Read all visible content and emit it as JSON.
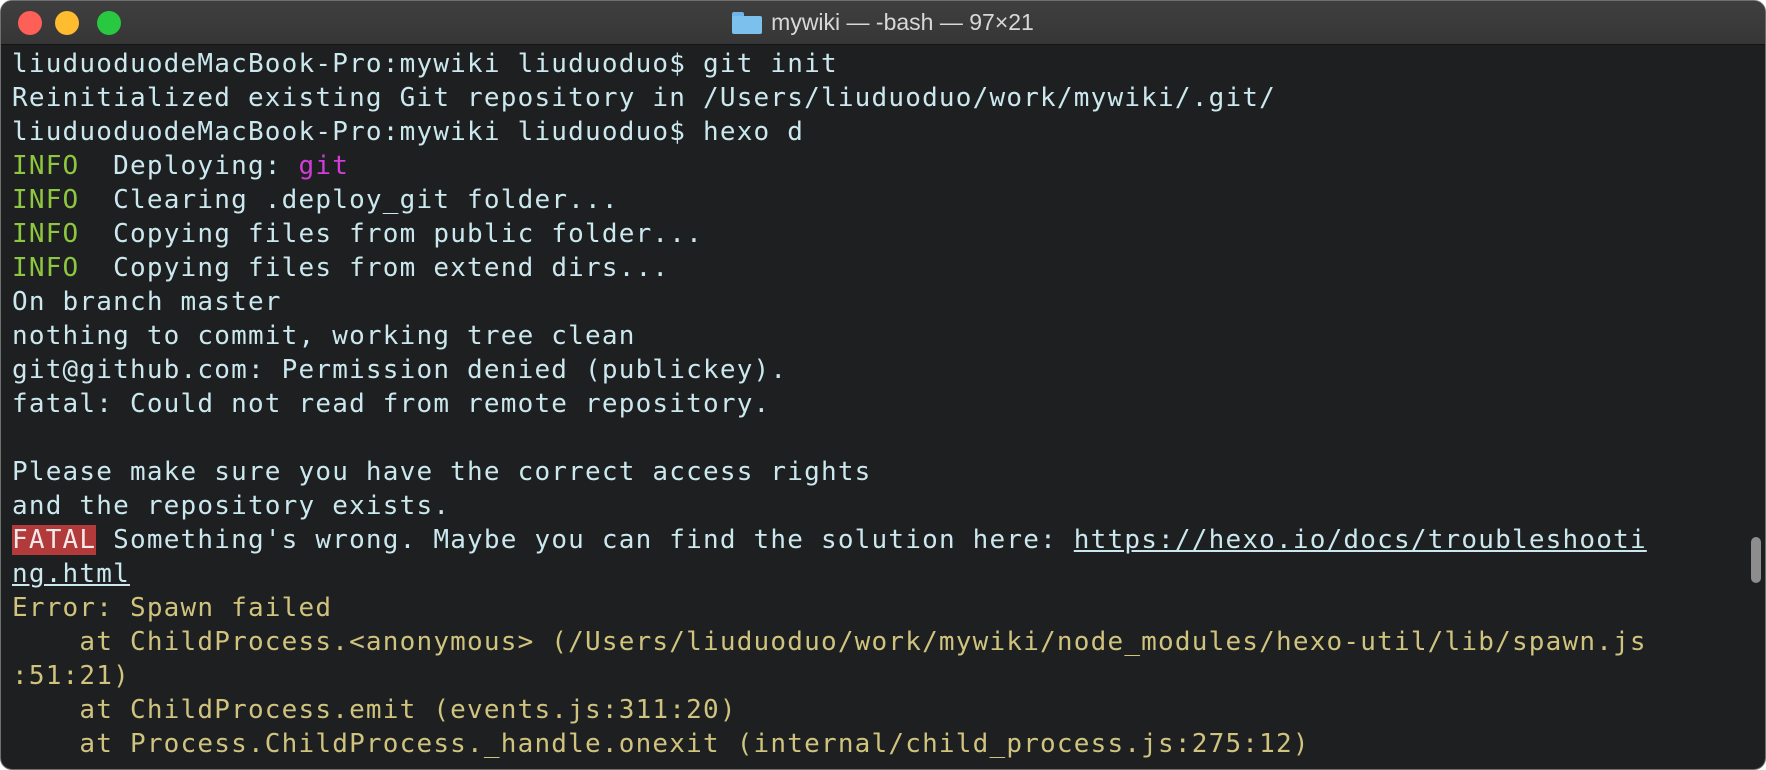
{
  "window": {
    "title": "mywiki — -bash — 97×21"
  },
  "terminal": {
    "lines": [
      {
        "parts": [
          {
            "text": "liuduoduodeMacBook-Pro:mywiki liuduoduo$ git init",
            "style": ""
          }
        ]
      },
      {
        "parts": [
          {
            "text": "Reinitialized existing Git repository in /Users/liuduoduo/work/mywiki/.git/",
            "style": ""
          }
        ]
      },
      {
        "parts": [
          {
            "text": "liuduoduodeMacBook-Pro:mywiki liuduoduo$ hexo d",
            "style": ""
          }
        ]
      },
      {
        "parts": [
          {
            "text": "INFO",
            "style": "green"
          },
          {
            "text": "  Deploying: ",
            "style": ""
          },
          {
            "text": "git",
            "style": "magenta"
          }
        ]
      },
      {
        "parts": [
          {
            "text": "INFO",
            "style": "green"
          },
          {
            "text": "  Clearing .deploy_git folder...",
            "style": ""
          }
        ]
      },
      {
        "parts": [
          {
            "text": "INFO",
            "style": "green"
          },
          {
            "text": "  Copying files from public folder...",
            "style": ""
          }
        ]
      },
      {
        "parts": [
          {
            "text": "INFO",
            "style": "green"
          },
          {
            "text": "  Copying files from extend dirs...",
            "style": ""
          }
        ]
      },
      {
        "parts": [
          {
            "text": "On branch master",
            "style": ""
          }
        ]
      },
      {
        "parts": [
          {
            "text": "nothing to commit, working tree clean",
            "style": ""
          }
        ]
      },
      {
        "parts": [
          {
            "text": "git@github.com: Permission denied (publickey).",
            "style": ""
          }
        ]
      },
      {
        "parts": [
          {
            "text": "fatal: Could not read from remote repository.",
            "style": ""
          }
        ]
      },
      {
        "parts": [
          {
            "text": "",
            "style": ""
          }
        ]
      },
      {
        "parts": [
          {
            "text": "Please make sure you have the correct access rights",
            "style": ""
          }
        ]
      },
      {
        "parts": [
          {
            "text": "and the repository exists.",
            "style": ""
          }
        ]
      },
      {
        "parts": [
          {
            "text": "FATAL",
            "style": "fatal"
          },
          {
            "text": " Something's wrong. Maybe you can find the solution here: ",
            "style": ""
          },
          {
            "text": "https://hexo.io/docs/troubleshooti",
            "style": "link"
          }
        ]
      },
      {
        "parts": [
          {
            "text": "ng.html",
            "style": "link"
          }
        ]
      },
      {
        "parts": [
          {
            "text": "Error: Spawn failed",
            "style": "yellow"
          }
        ]
      },
      {
        "parts": [
          {
            "text": "    at ChildProcess.<anonymous> (/Users/liuduoduo/work/mywiki/node_modules/hexo-util/lib/spawn.js",
            "style": "yellow"
          }
        ]
      },
      {
        "parts": [
          {
            "text": ":51:21)",
            "style": "yellow"
          }
        ]
      },
      {
        "parts": [
          {
            "text": "    at ChildProcess.emit (events.js:311:20)",
            "style": "yellow"
          }
        ]
      },
      {
        "parts": [
          {
            "text": "    at Process.ChildProcess._handle.onexit (internal/child_process.js:275:12)",
            "style": "yellow"
          }
        ]
      }
    ]
  },
  "icons": {
    "folder": "folder-icon",
    "close": "close-icon",
    "minimize": "minimize-icon",
    "maximize": "maximize-icon"
  },
  "colors": {
    "background": "#1d1f21",
    "text": "#cbe8ee",
    "info": "#8dc63f",
    "accent": "#d23cd9",
    "error": "#cfc37e",
    "fatal_bg": "#b23a3a"
  }
}
